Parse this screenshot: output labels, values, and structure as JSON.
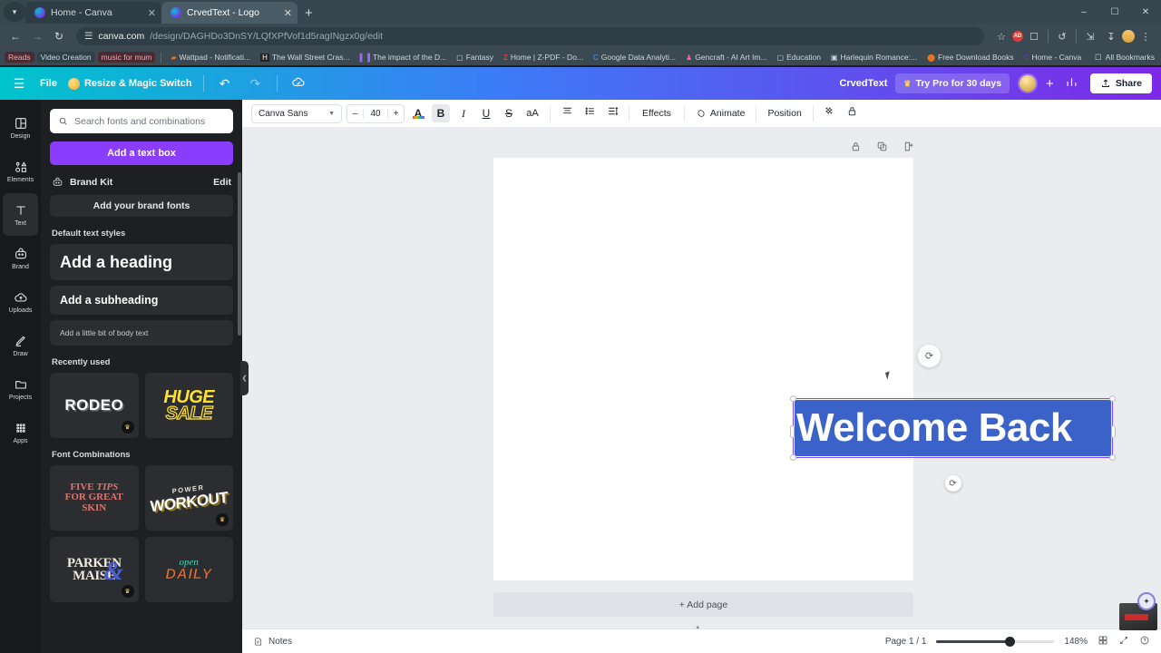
{
  "browser": {
    "tabs": [
      {
        "title": "Home - Canva",
        "active": false
      },
      {
        "title": "CrvedText - Logo",
        "active": true
      }
    ],
    "new_tab_label": "+",
    "window_controls": [
      "–",
      "☐",
      "✕"
    ],
    "url_host": "canva.com",
    "url_path": "/design/DAGHDo3DnSY/LQfXPfVof1d5ragINgzx0g/edit",
    "bookmarks": [
      {
        "label": "Reads",
        "style": "pill"
      },
      {
        "label": "Video Creation",
        "style": "pill2"
      },
      {
        "label": "music for mum",
        "style": "pill"
      },
      {
        "label": "Wattpad - Notificati...",
        "style": "plain",
        "icon": "▰"
      },
      {
        "label": "The Wall Street Cras...",
        "style": "plain",
        "icon": "H"
      },
      {
        "label": "The impact of the D...",
        "style": "plain",
        "icon": "▌▐"
      },
      {
        "label": "Fantasy",
        "style": "plain",
        "icon": "▢"
      },
      {
        "label": "Home | Z-PDF - Do...",
        "style": "plain",
        "icon": "Z"
      },
      {
        "label": "Google Data Analyti...",
        "style": "plain",
        "icon": "C"
      },
      {
        "label": "Gencraft - AI Art Im...",
        "style": "plain",
        "icon": "♟"
      },
      {
        "label": "Education",
        "style": "plain",
        "icon": "▢"
      },
      {
        "label": "Harlequin Romance:...",
        "style": "plain",
        "icon": "▣"
      },
      {
        "label": "Free Download Books",
        "style": "plain",
        "icon": "⬤"
      },
      {
        "label": "Home - Canva",
        "style": "plain",
        "icon": "C"
      }
    ],
    "all_bookmarks": "All Bookmarks"
  },
  "canva_top": {
    "menu_icon": "hamburger-icon",
    "file_label": "File",
    "resize_label": "Resize & Magic Switch",
    "undo_icon": "↶",
    "redo_icon": "↷",
    "cloud_icon": "cloud-saved-icon",
    "doc_title": "CrvedText",
    "try_pro_label": "Try Pro for 30 days",
    "plus_label": "+",
    "stats_icon": "bar-chart-icon",
    "share_label": "Share"
  },
  "rail": {
    "items": [
      {
        "label": "Design",
        "icon": "design-icon",
        "active": false
      },
      {
        "label": "Elements",
        "icon": "elements-icon",
        "active": false
      },
      {
        "label": "Text",
        "icon": "text-icon",
        "active": true
      },
      {
        "label": "Brand",
        "icon": "brand-icon",
        "active": false
      },
      {
        "label": "Uploads",
        "icon": "uploads-icon",
        "active": false
      },
      {
        "label": "Draw",
        "icon": "draw-icon",
        "active": false
      },
      {
        "label": "Projects",
        "icon": "projects-icon",
        "active": false
      },
      {
        "label": "Apps",
        "icon": "apps-icon",
        "active": false
      }
    ]
  },
  "panel": {
    "search_placeholder": "Search fonts and combinations",
    "add_text_box": "Add a text box",
    "brand_kit_label": "Brand Kit",
    "brand_kit_edit": "Edit",
    "add_brand_fonts": "Add your brand fonts",
    "default_styles_title": "Default text styles",
    "heading": "Add a heading",
    "subheading": "Add a subheading",
    "body": "Add a little bit of body text",
    "recently_used_title": "Recently used",
    "recent": [
      {
        "label": "RODEO",
        "pro": true
      },
      {
        "label": "HUGE SALE",
        "pro": false
      }
    ],
    "combinations_title": "Font Combinations",
    "combinations": [
      {
        "label": "FIVE TIPS FOR GREAT SKIN",
        "pro": false
      },
      {
        "label": "POWER WORKOUT",
        "pro": true
      },
      {
        "label": "PARKEN & MAISE",
        "pro": true
      },
      {
        "label": "open DAILY",
        "pro": false
      }
    ]
  },
  "toolbar": {
    "font_name": "Canva Sans",
    "font_dropdown_icon": "chevron-down-icon",
    "size_minus": "–",
    "font_size": "40",
    "size_plus": "+",
    "text_color_icon": "text-color-icon",
    "bold": "B",
    "italic": "I",
    "underline": "U",
    "strikethrough": "S",
    "case": "aA",
    "align_icon": "align-icon",
    "list_icon": "bullet-list-icon",
    "spacing_icon": "line-spacing-icon",
    "effects": "Effects",
    "animate": "Animate",
    "position": "Position",
    "transparency_icon": "transparency-icon",
    "lock_icon": "lock-icon"
  },
  "canvas": {
    "text_value": "Welcome Back",
    "lock_icon": "lock-icon",
    "duplicate_icon": "duplicate-icon",
    "add_page_icon": "add-page-icon",
    "rotate_icon": "⟳",
    "comment_icon": "⟳",
    "add_page_label": "+ Add page"
  },
  "bottom": {
    "notes_label": "Notes",
    "page_indicator": "Page 1 / 1",
    "zoom_level": "148%",
    "grid_icon": "grid-view-icon",
    "fullscreen_icon": "fullscreen-icon",
    "help_icon": "?"
  }
}
